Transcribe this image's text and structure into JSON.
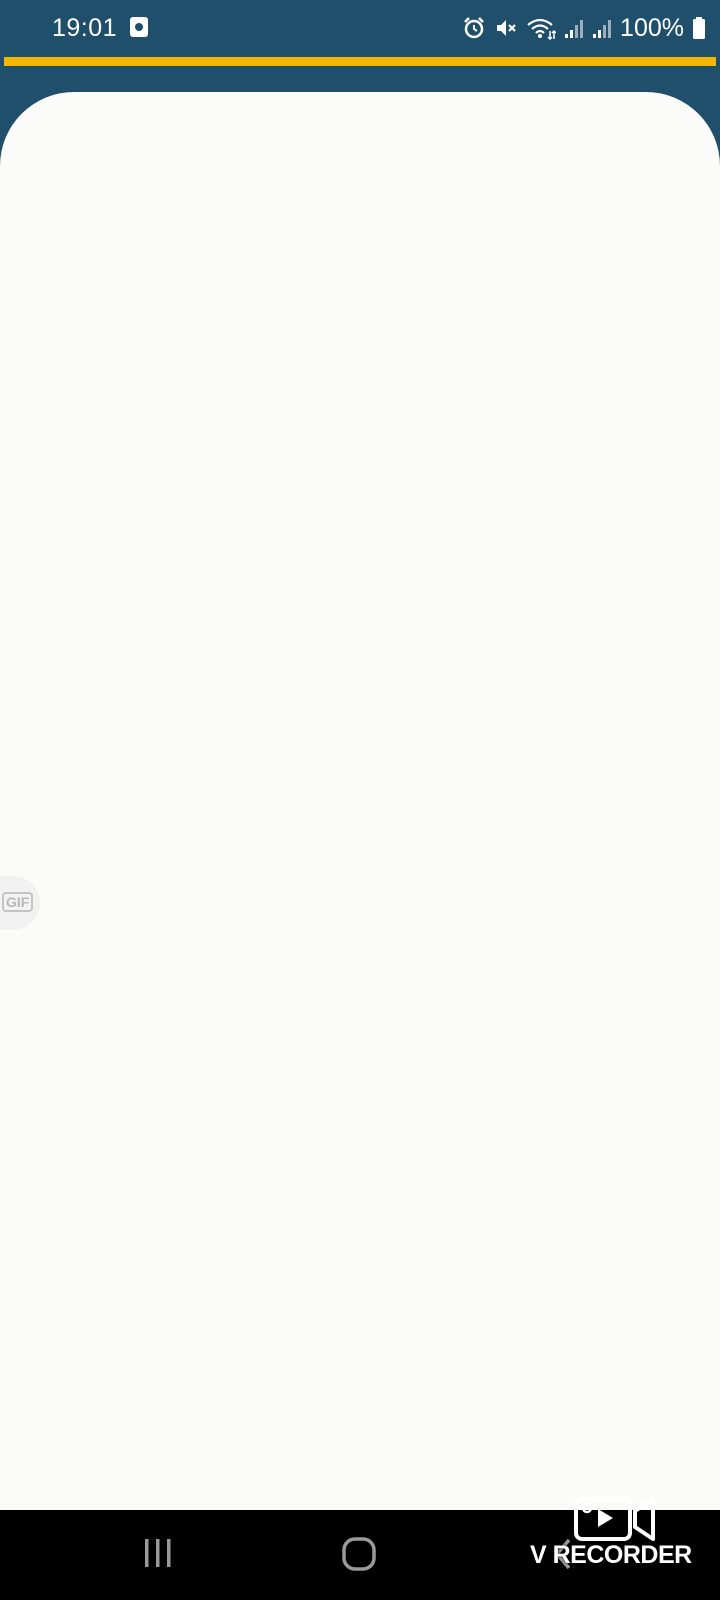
{
  "status_bar": {
    "time": "19:01",
    "battery_percent": "100%",
    "icons": [
      "screen-recorder-icon",
      "alarm-icon",
      "mute-icon",
      "wifi-icon",
      "signal-icon",
      "signal-icon-2",
      "battery-icon"
    ]
  },
  "colors": {
    "header_background": "#1f4f6b",
    "accent": "#f2b705",
    "content_background": "#fbfbfa"
  },
  "floating_button": {
    "label": "GIF"
  },
  "watermark": {
    "text": "V RECORDER"
  },
  "navigation": {
    "buttons": [
      "recent-apps",
      "home",
      "back"
    ]
  }
}
